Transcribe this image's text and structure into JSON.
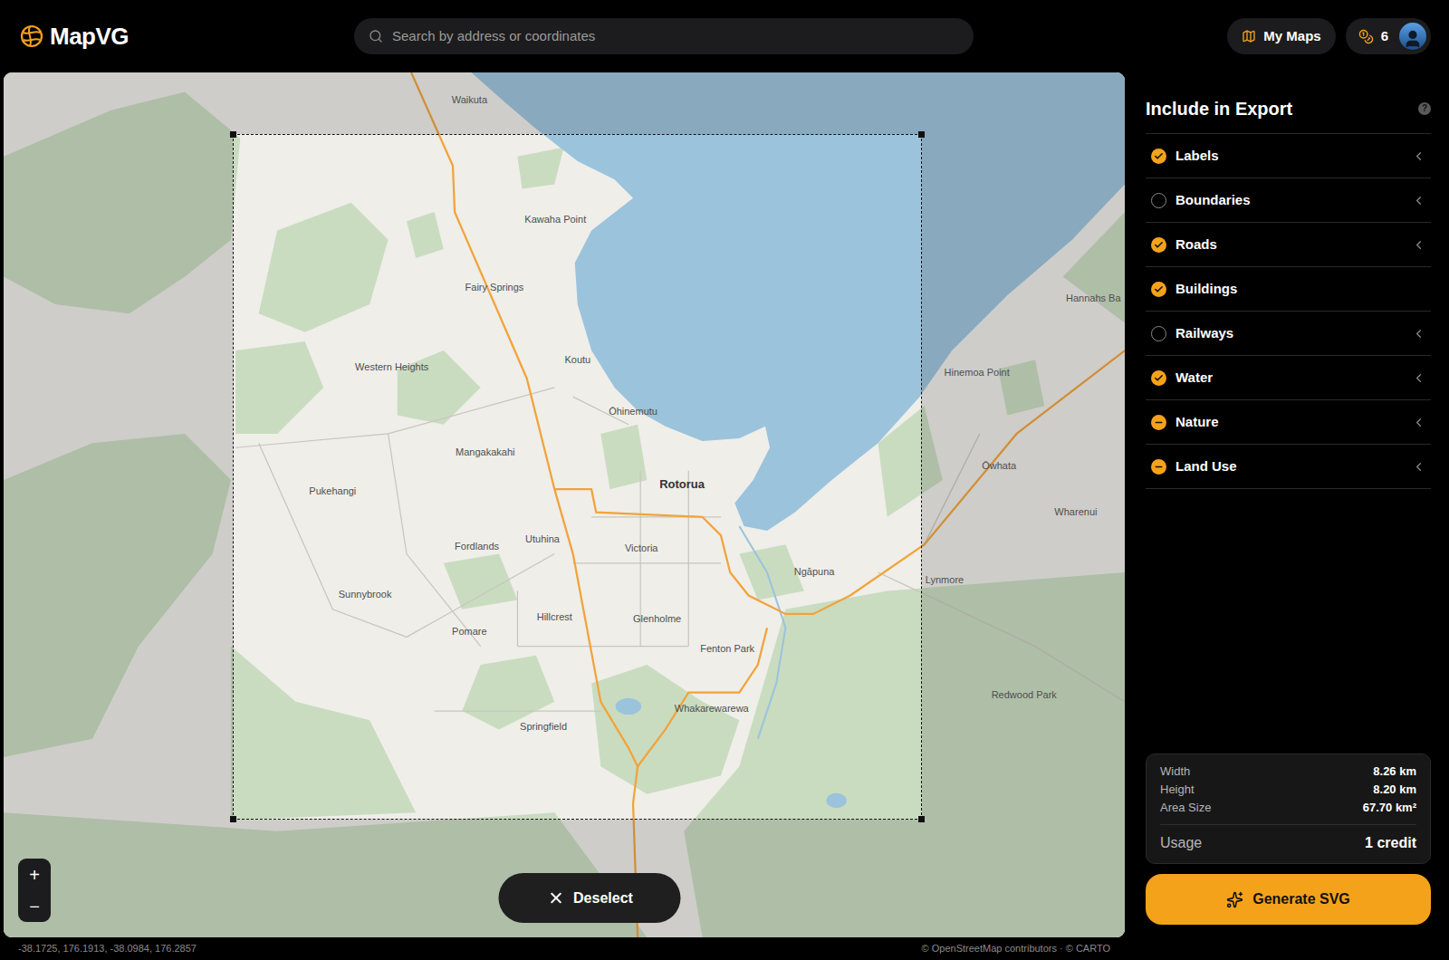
{
  "app": {
    "name": "MapVG"
  },
  "search": {
    "placeholder": "Search by address or coordinates"
  },
  "header": {
    "my_maps": "My Maps",
    "credits": "6"
  },
  "map": {
    "places": [
      {
        "name": "Waikuta",
        "bold": false
      },
      {
        "name": "Kawaha Point",
        "bold": false
      },
      {
        "name": "Fairy Springs",
        "bold": false
      },
      {
        "name": "Western Heights",
        "bold": false
      },
      {
        "name": "Koutu",
        "bold": false
      },
      {
        "name": "Ōhinemutu",
        "bold": false
      },
      {
        "name": "Mangakakahi",
        "bold": false
      },
      {
        "name": "Rotorua",
        "bold": true
      },
      {
        "name": "Pukehangi",
        "bold": false
      },
      {
        "name": "Utuhina",
        "bold": false
      },
      {
        "name": "Fordlands",
        "bold": false
      },
      {
        "name": "Victoria",
        "bold": false
      },
      {
        "name": "Ngāpuna",
        "bold": false
      },
      {
        "name": "Sunnybrook",
        "bold": false
      },
      {
        "name": "Hillcrest",
        "bold": false
      },
      {
        "name": "Glenholme",
        "bold": false
      },
      {
        "name": "Pomare",
        "bold": false
      },
      {
        "name": "Fenton Park",
        "bold": false
      },
      {
        "name": "Whakarewarewa",
        "bold": false
      },
      {
        "name": "Springfield",
        "bold": false
      },
      {
        "name": "Hannahs Ba",
        "bold": false
      },
      {
        "name": "Hinemoa Point",
        "bold": false
      },
      {
        "name": "Ōwhata",
        "bold": false
      },
      {
        "name": "Wharenui",
        "bold": false
      },
      {
        "name": "Lynmore",
        "bold": false
      },
      {
        "name": "Redwood Park",
        "bold": false
      }
    ],
    "zoom": [
      "+",
      "−"
    ],
    "deselect": "Deselect"
  },
  "export": {
    "title": "Include in Export",
    "help": "?",
    "layers": [
      {
        "label": "Labels",
        "checked": true,
        "partial": false,
        "expandable": true
      },
      {
        "label": "Boundaries",
        "checked": false,
        "partial": false,
        "expandable": true
      },
      {
        "label": "Roads",
        "checked": true,
        "partial": false,
        "expandable": true
      },
      {
        "label": "Buildings",
        "checked": true,
        "partial": false,
        "expandable": false
      },
      {
        "label": "Railways",
        "checked": false,
        "partial": false,
        "expandable": true
      },
      {
        "label": "Water",
        "checked": true,
        "partial": false,
        "expandable": true
      },
      {
        "label": "Nature",
        "checked": false,
        "partial": true,
        "expandable": true
      },
      {
        "label": "Land Use",
        "checked": false,
        "partial": true,
        "expandable": true
      }
    ]
  },
  "stats": [
    {
      "label": "Width",
      "value": "8.26 km"
    },
    {
      "label": "Height",
      "value": "8.20 km"
    },
    {
      "label": "Area Size",
      "value": "67.70 km²"
    }
  ],
  "usage": {
    "label": "Usage",
    "value": "1 credit"
  },
  "generate_button": "Generate SVG",
  "footer": {
    "coordinates": "-38.1725, 176.1913, -38.0984, 176.2857",
    "attribution": "© OpenStreetMap contributors · © CARTO"
  }
}
